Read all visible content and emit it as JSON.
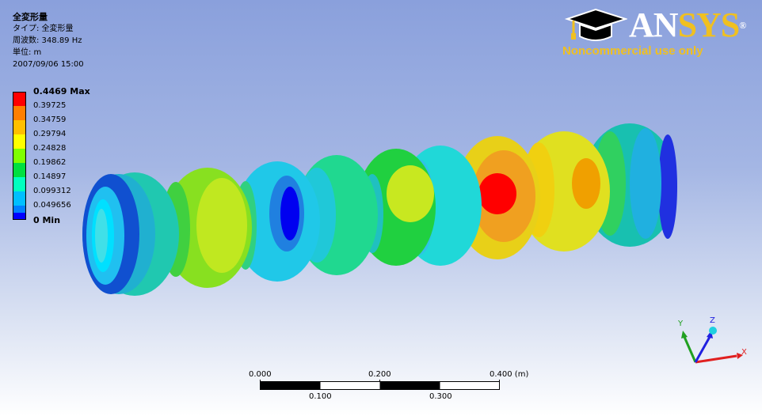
{
  "header": {
    "title": "全変形量",
    "type_line": "タイプ: 全変形量",
    "frequency_line": "周波数: 348.89 Hz",
    "unit_line": "単位: m",
    "date_line": "2007/09/06 15:00"
  },
  "legend": {
    "entries": [
      {
        "label": "0.4469 Max",
        "color": "#ff0000"
      },
      {
        "label": "0.39725",
        "color": "#ff7f00"
      },
      {
        "label": "0.34759",
        "color": "#ffbf00"
      },
      {
        "label": "0.29794",
        "color": "#ffff00"
      },
      {
        "label": "0.24828",
        "color": "#7fff00"
      },
      {
        "label": "0.19862",
        "color": "#00e040"
      },
      {
        "label": "0.14897",
        "color": "#00ffbf"
      },
      {
        "label": "0.099312",
        "color": "#00bfff"
      },
      {
        "label": "0.049656",
        "color": "#007fff"
      }
    ],
    "min_label": "0 Min",
    "min_color": "#0000ff"
  },
  "logo": {
    "brand_an": "AN",
    "brand_sys": "SYS",
    "registered": "®",
    "note": "Noncommercial use only",
    "icon": "graduation-cap-icon"
  },
  "scale_bar": {
    "top_labels": [
      "0.000",
      "0.200",
      "0.400 (m)"
    ],
    "bottom_labels": [
      "0.100",
      "0.300"
    ]
  },
  "triad": {
    "x_label": "X",
    "y_label": "Y",
    "z_label": "Z"
  }
}
